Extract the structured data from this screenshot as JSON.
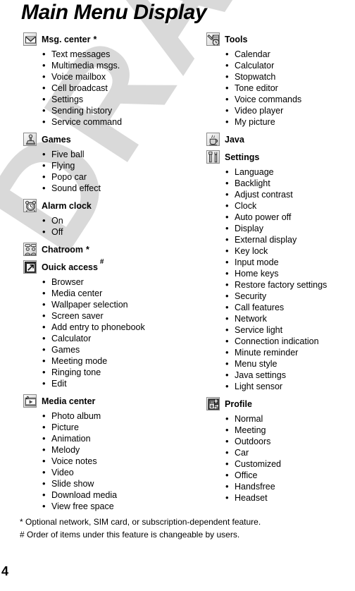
{
  "page": {
    "title": "Main Menu Display",
    "page_number": "4",
    "watermark": "DRAFT",
    "watermark_color": "#d9d9d9"
  },
  "footnotes": [
    "* Optional network, SIM card, or subscription-dependent feature.",
    "# Order of items under this feature is changeable by users."
  ],
  "left_column": [
    {
      "icon": "envelope-icon",
      "title": "Msg. center",
      "marker": "*",
      "items": [
        "Text messages",
        "Multimedia msgs.",
        "Voice mailbox",
        "Cell broadcast",
        "Settings",
        "Sending history",
        "Service command"
      ]
    },
    {
      "icon": "joystick-icon",
      "title": "Games",
      "marker": "",
      "items": [
        "Five ball",
        "Flying",
        "Popo car",
        "Sound effect"
      ]
    },
    {
      "icon": "alarm-clock-icon",
      "title": "Alarm clock",
      "marker": "",
      "items": [
        "On",
        "Off"
      ]
    },
    {
      "icon": "chatroom-people-icon",
      "title": "Chatroom",
      "marker": "*",
      "items": []
    },
    {
      "icon": "quick-access-arrow-icon",
      "title": "Ouick access",
      "marker": "#",
      "items": [
        "Browser",
        "Media center",
        "Wallpaper selection",
        "Screen saver",
        "Add entry to phonebook",
        "Calculator",
        "Games",
        "Meeting mode",
        "Ringing tone",
        "Edit"
      ]
    },
    {
      "icon": "media-center-icon",
      "title": "Media center",
      "marker": "",
      "items": [
        "Photo album",
        "Picture",
        "Animation",
        "Melody",
        "Voice notes",
        "Video",
        "Slide show",
        "Download media",
        "View free space"
      ]
    }
  ],
  "right_column": [
    {
      "icon": "tools-icon",
      "title": "Tools",
      "marker": "",
      "items": [
        "Calendar",
        "Calculator",
        "Stopwatch",
        "Tone editor",
        "Voice commands",
        "Video player",
        "My picture"
      ]
    },
    {
      "icon": "java-cup-icon",
      "title": "Java",
      "marker": "",
      "items": []
    },
    {
      "icon": "settings-tools-icon",
      "title": "Settings",
      "marker": "",
      "items": [
        "Language",
        "Backlight",
        "Adjust contrast",
        "Clock",
        "Auto power off",
        "Display",
        "External display",
        "Key lock",
        "Input mode",
        "Home keys",
        "Restore factory settings",
        "Security",
        "Call features",
        "Network",
        "Service light",
        "Connection indication",
        "Minute reminder",
        "Menu style",
        "Java settings",
        "Light sensor"
      ]
    },
    {
      "icon": "profile-icon",
      "title": "Profile",
      "marker": "",
      "items": [
        "Normal",
        "Meeting",
        "Outdoors",
        "Car",
        "Customized",
        "Office",
        "Handsfree",
        "Headset"
      ]
    }
  ]
}
